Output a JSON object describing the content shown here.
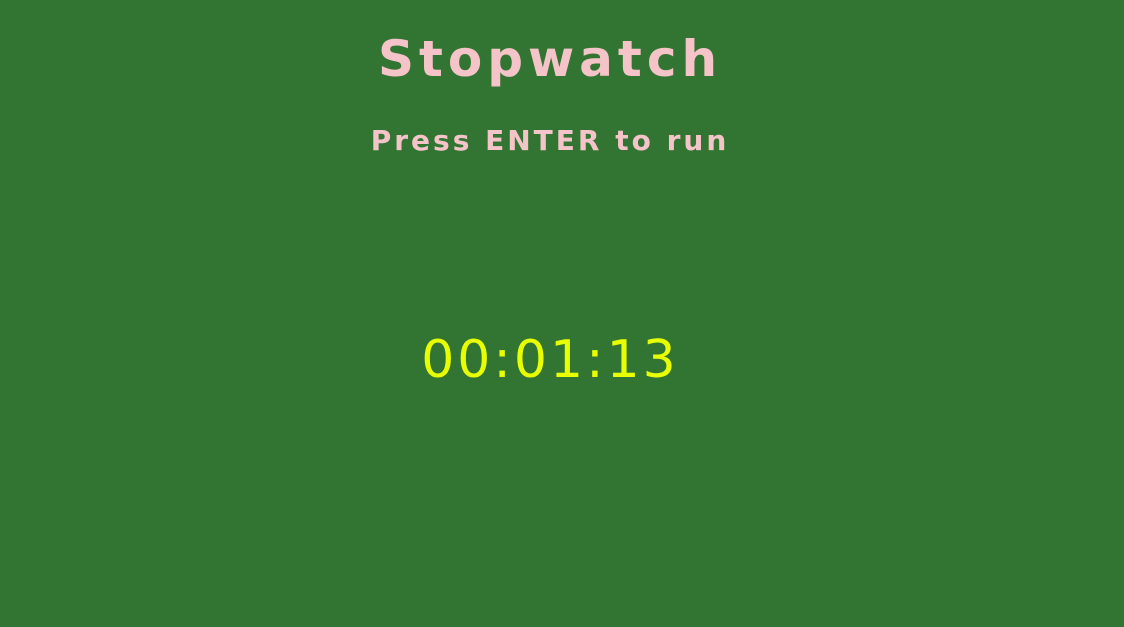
{
  "app": {
    "title": "Stopwatch",
    "instruction": "Press ENTER to run",
    "time_display": "00:01:13"
  },
  "colors": {
    "background": "#327532",
    "title_text": "#f5c4c8",
    "timer_text": "#e8ff00"
  }
}
